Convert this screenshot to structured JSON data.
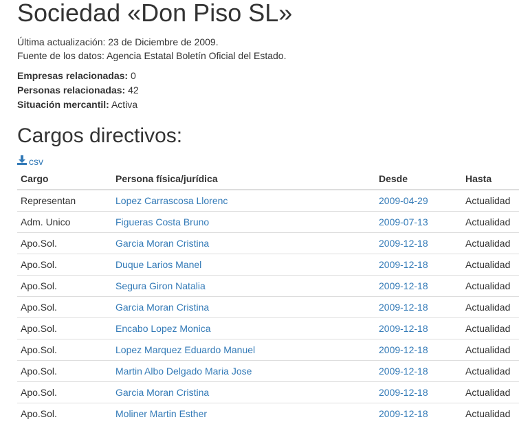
{
  "title": "Sociedad «Don Piso SL»",
  "meta": {
    "updated": "Última actualización: 23 de Diciembre de 2009.",
    "source": "Fuente de los datos: Agencia Estatal Boletín Oficial del Estado."
  },
  "stats": {
    "empresas_label": "Empresas relacionadas:",
    "empresas_value": "0",
    "personas_label": "Personas relacionadas:",
    "personas_value": "42",
    "situacion_label": "Situación mercantil:",
    "situacion_value": "Activa"
  },
  "section_title": "Cargos directivos:",
  "csv_label": "csv",
  "table": {
    "headers": [
      "Cargo",
      "Persona física/jurídica",
      "Desde",
      "Hasta"
    ],
    "rows": [
      {
        "cargo": "Representan",
        "persona": "Lopez Carrascosa Llorenc",
        "desde": "2009-04-29",
        "hasta": "Actualidad"
      },
      {
        "cargo": "Adm. Unico",
        "persona": "Figueras Costa Bruno",
        "desde": "2009-07-13",
        "hasta": "Actualidad"
      },
      {
        "cargo": "Apo.Sol.",
        "persona": "Garcia Moran Cristina",
        "desde": "2009-12-18",
        "hasta": "Actualidad"
      },
      {
        "cargo": "Apo.Sol.",
        "persona": "Duque Larios Manel",
        "desde": "2009-12-18",
        "hasta": "Actualidad"
      },
      {
        "cargo": "Apo.Sol.",
        "persona": "Segura Giron Natalia",
        "desde": "2009-12-18",
        "hasta": "Actualidad"
      },
      {
        "cargo": "Apo.Sol.",
        "persona": "Garcia Moran Cristina",
        "desde": "2009-12-18",
        "hasta": "Actualidad"
      },
      {
        "cargo": "Apo.Sol.",
        "persona": "Encabo Lopez Monica",
        "desde": "2009-12-18",
        "hasta": "Actualidad"
      },
      {
        "cargo": "Apo.Sol.",
        "persona": "Lopez Marquez Eduardo Manuel",
        "desde": "2009-12-18",
        "hasta": "Actualidad"
      },
      {
        "cargo": "Apo.Sol.",
        "persona": "Martin Albo Delgado Maria Jose",
        "desde": "2009-12-18",
        "hasta": "Actualidad"
      },
      {
        "cargo": "Apo.Sol.",
        "persona": "Garcia Moran Cristina",
        "desde": "2009-12-18",
        "hasta": "Actualidad"
      },
      {
        "cargo": "Apo.Sol.",
        "persona": "Moliner Martin Esther",
        "desde": "2009-12-18",
        "hasta": "Actualidad"
      }
    ]
  },
  "colors": {
    "link": "#337ab7",
    "text": "#333333",
    "border": "#dddddd"
  },
  "icons": {
    "csv": "download-icon"
  }
}
